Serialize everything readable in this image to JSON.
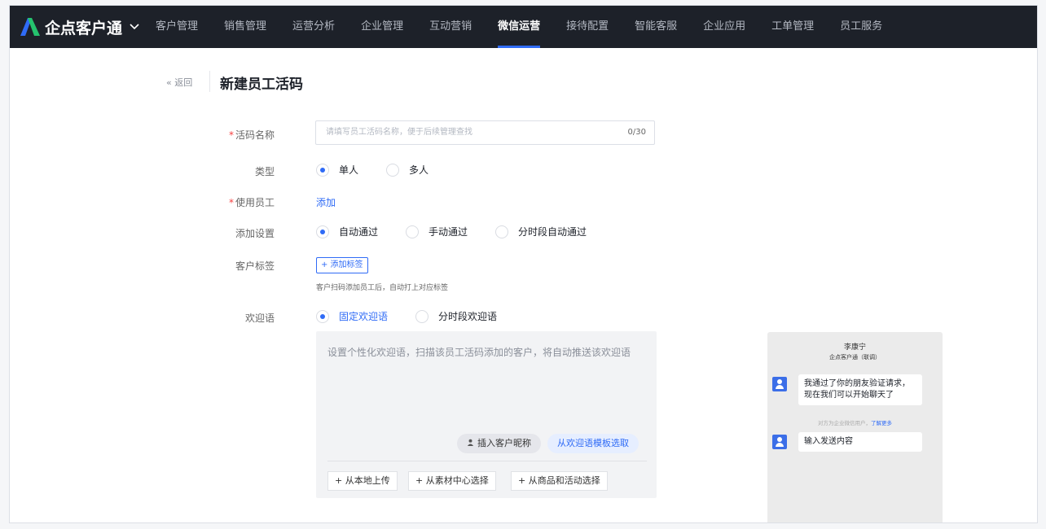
{
  "brand": {
    "name": "企点客户通",
    "chevron": "⌄"
  },
  "nav": {
    "items": [
      {
        "label": "客户管理"
      },
      {
        "label": "销售管理"
      },
      {
        "label": "运营分析"
      },
      {
        "label": "企业管理"
      },
      {
        "label": "互动营销"
      },
      {
        "label": "微信运营",
        "active": true
      },
      {
        "label": "接待配置"
      },
      {
        "label": "智能客服"
      },
      {
        "label": "企业应用"
      },
      {
        "label": "工单管理"
      },
      {
        "label": "员工服务"
      }
    ]
  },
  "header": {
    "back": "« 返回",
    "title": "新建员工活码"
  },
  "form": {
    "name": {
      "label": "活码名称",
      "required": "*",
      "placeholder": "请填写员工活码名称，便于后续管理查找",
      "counter": "0/30"
    },
    "type": {
      "label": "类型",
      "options": [
        "单人",
        "多人"
      ],
      "selected": "单人"
    },
    "staff": {
      "label": "使用员工",
      "required": "*",
      "action": "添加"
    },
    "add_setting": {
      "label": "添加设置",
      "options": [
        "自动通过",
        "手动通过",
        "分时段自动通过"
      ],
      "selected": "自动通过"
    },
    "tags": {
      "label": "客户标签",
      "button": "+ 添加标签",
      "hint": "客户扫码添加员工后，自动打上对应标签"
    },
    "welcome": {
      "label": "欢迎语",
      "options": [
        "固定欢迎语",
        "分时段欢迎语"
      ],
      "selected": "固定欢迎语",
      "placeholder": "设置个性化欢迎语，扫描该员工活码添加的客户，将自动推送该欢迎语",
      "insert_nickname": "插入客户昵称",
      "from_template": "从欢迎语模板选取",
      "upload_local": "+  从本地上传",
      "from_material": "+  从素材中心选择",
      "from_goods": "+  从商品和活动选择"
    }
  },
  "preview": {
    "contact_name": "李康宁",
    "contact_sub": "企点客户通（联调）",
    "message1": "我通过了你的朋友验证请求，现在我们可以开始聊天了",
    "note": "对方为企业微信用户，",
    "note_link": "了解更多",
    "message2": "输入发送内容"
  },
  "colors": {
    "nav_bg": "#1d2129",
    "accent": "#2f6bf6",
    "required": "#f53f3f"
  }
}
